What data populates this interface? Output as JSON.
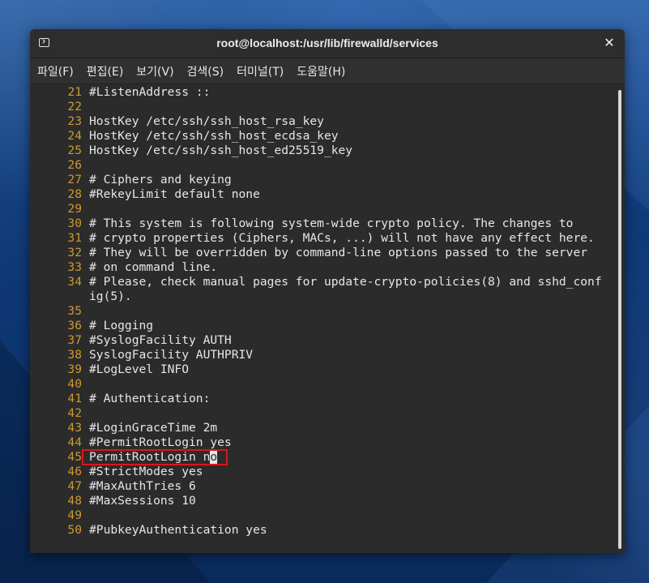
{
  "window": {
    "title": "root@localhost:/usr/lib/firewalld/services",
    "close_glyph": "✕"
  },
  "menu": [
    {
      "label": "파일(F)"
    },
    {
      "label": "편집(E)"
    },
    {
      "label": "보기(V)"
    },
    {
      "label": "검색(S)"
    },
    {
      "label": "터미널(T)"
    },
    {
      "label": "도움말(H)"
    }
  ],
  "editor": {
    "lines": [
      {
        "num": "21",
        "text": "#ListenAddress ::"
      },
      {
        "num": "22",
        "text": ""
      },
      {
        "num": "23",
        "text": "HostKey /etc/ssh/ssh_host_rsa_key"
      },
      {
        "num": "24",
        "text": "HostKey /etc/ssh/ssh_host_ecdsa_key"
      },
      {
        "num": "25",
        "text": "HostKey /etc/ssh/ssh_host_ed25519_key"
      },
      {
        "num": "26",
        "text": ""
      },
      {
        "num": "27",
        "text": "# Ciphers and keying"
      },
      {
        "num": "28",
        "text": "#RekeyLimit default none"
      },
      {
        "num": "29",
        "text": ""
      },
      {
        "num": "30",
        "text": "# This system is following system-wide crypto policy. The changes to"
      },
      {
        "num": "31",
        "text": "# crypto properties (Ciphers, MACs, ...) will not have any effect here."
      },
      {
        "num": "32",
        "text": "# They will be overridden by command-line options passed to the server"
      },
      {
        "num": "33",
        "text": "# on command line."
      },
      {
        "num": "34",
        "text": "# Please, check manual pages for update-crypto-policies(8) and sshd_conf"
      },
      {
        "num": "",
        "text": "ig(5)."
      },
      {
        "num": "35",
        "text": ""
      },
      {
        "num": "36",
        "text": "# Logging"
      },
      {
        "num": "37",
        "text": "#SyslogFacility AUTH"
      },
      {
        "num": "38",
        "text": "SyslogFacility AUTHPRIV"
      },
      {
        "num": "39",
        "text": "#LogLevel INFO"
      },
      {
        "num": "40",
        "text": ""
      },
      {
        "num": "41",
        "text": "# Authentication:"
      },
      {
        "num": "42",
        "text": ""
      },
      {
        "num": "43",
        "text": "#LoginGraceTime 2m"
      },
      {
        "num": "44",
        "text": "#PermitRootLogin yes"
      },
      {
        "num": "45",
        "text": "PermitRootLogin n",
        "cursor_char": "o",
        "highlighted": true
      },
      {
        "num": "46",
        "text": "#StrictModes yes"
      },
      {
        "num": "47",
        "text": "#MaxAuthTries 6"
      },
      {
        "num": "48",
        "text": "#MaxSessions 10"
      },
      {
        "num": "49",
        "text": ""
      },
      {
        "num": "50",
        "text": "#PubkeyAuthentication yes"
      }
    ]
  },
  "colors": {
    "line_number": "#d0982e",
    "text": "#e6e6e6",
    "background": "#2b2b2b",
    "highlight_border": "#e0141a"
  },
  "icons": {
    "window_icon": "terminal-icon",
    "close": "close-icon"
  }
}
